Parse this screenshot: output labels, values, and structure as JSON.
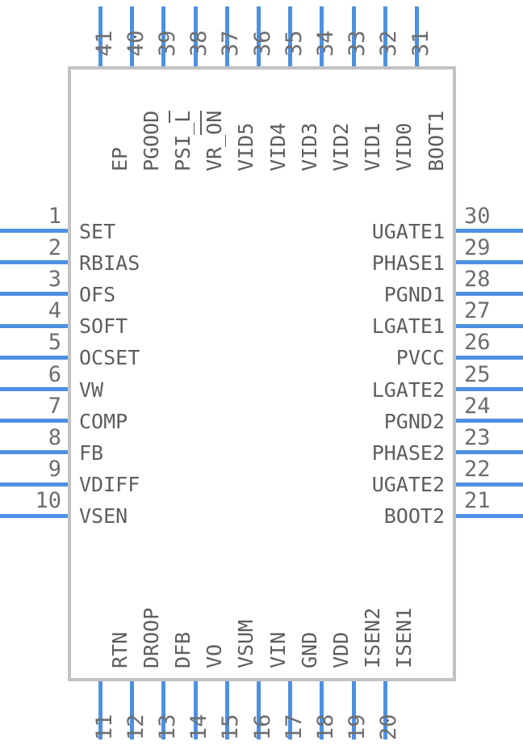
{
  "symbol": {
    "kind": "ic-schematic-symbol",
    "colors": {
      "pin_line": "#4d90e2",
      "body_border": "#c2c2c2",
      "text": "#5e5e5e",
      "number_text": "#6e6e6e",
      "background": "#ffffff"
    },
    "left_pins": [
      {
        "number": "1",
        "name": "SET"
      },
      {
        "number": "2",
        "name": "RBIAS"
      },
      {
        "number": "3",
        "name": "OFS"
      },
      {
        "number": "4",
        "name": "SOFT"
      },
      {
        "number": "5",
        "name": "OCSET"
      },
      {
        "number": "6",
        "name": "VW"
      },
      {
        "number": "7",
        "name": "COMP"
      },
      {
        "number": "8",
        "name": "FB"
      },
      {
        "number": "9",
        "name": "VDIFF"
      },
      {
        "number": "10",
        "name": "VSEN"
      }
    ],
    "bottom_pins": [
      {
        "number": "11",
        "name": "RTN"
      },
      {
        "number": "12",
        "name": "DROOP"
      },
      {
        "number": "13",
        "name": "DFB"
      },
      {
        "number": "14",
        "name": "VO"
      },
      {
        "number": "15",
        "name": "VSUM"
      },
      {
        "number": "16",
        "name": "VIN"
      },
      {
        "number": "17",
        "name": "GND"
      },
      {
        "number": "18",
        "name": "VDD"
      },
      {
        "number": "19",
        "name": "ISEN2"
      },
      {
        "number": "20",
        "name": "ISEN1"
      }
    ],
    "right_pins": [
      {
        "number": "30",
        "name": "UGATE1"
      },
      {
        "number": "29",
        "name": "PHASE1"
      },
      {
        "number": "28",
        "name": "PGND1"
      },
      {
        "number": "27",
        "name": "LGATE1"
      },
      {
        "number": "26",
        "name": "PVCC"
      },
      {
        "number": "25",
        "name": "LGATE2"
      },
      {
        "number": "24",
        "name": "PGND2"
      },
      {
        "number": "23",
        "name": "PHASE2"
      },
      {
        "number": "22",
        "name": "UGATE2"
      },
      {
        "number": "21",
        "name": "BOOT2"
      }
    ],
    "top_pins": [
      {
        "number": "41",
        "name": "EP",
        "prefix": "",
        "overbar": ""
      },
      {
        "number": "40",
        "name": "PGOOD",
        "prefix": "",
        "overbar": ""
      },
      {
        "number": "39",
        "name": "PSI_L",
        "prefix": "PSI_",
        "overbar": "L"
      },
      {
        "number": "38",
        "name": "VR_ON",
        "prefix": "VR_",
        "overbar": "ON"
      },
      {
        "number": "37",
        "name": "VID5",
        "prefix": "",
        "overbar": ""
      },
      {
        "number": "36",
        "name": "VID4",
        "prefix": "",
        "overbar": ""
      },
      {
        "number": "35",
        "name": "VID3",
        "prefix": "",
        "overbar": ""
      },
      {
        "number": "34",
        "name": "VID2",
        "prefix": "",
        "overbar": ""
      },
      {
        "number": "33",
        "name": "VID1",
        "prefix": "",
        "overbar": ""
      },
      {
        "number": "32",
        "name": "VID0",
        "prefix": "",
        "overbar": ""
      },
      {
        "number": "31",
        "name": "BOOT1",
        "prefix": "",
        "overbar": ""
      }
    ]
  }
}
